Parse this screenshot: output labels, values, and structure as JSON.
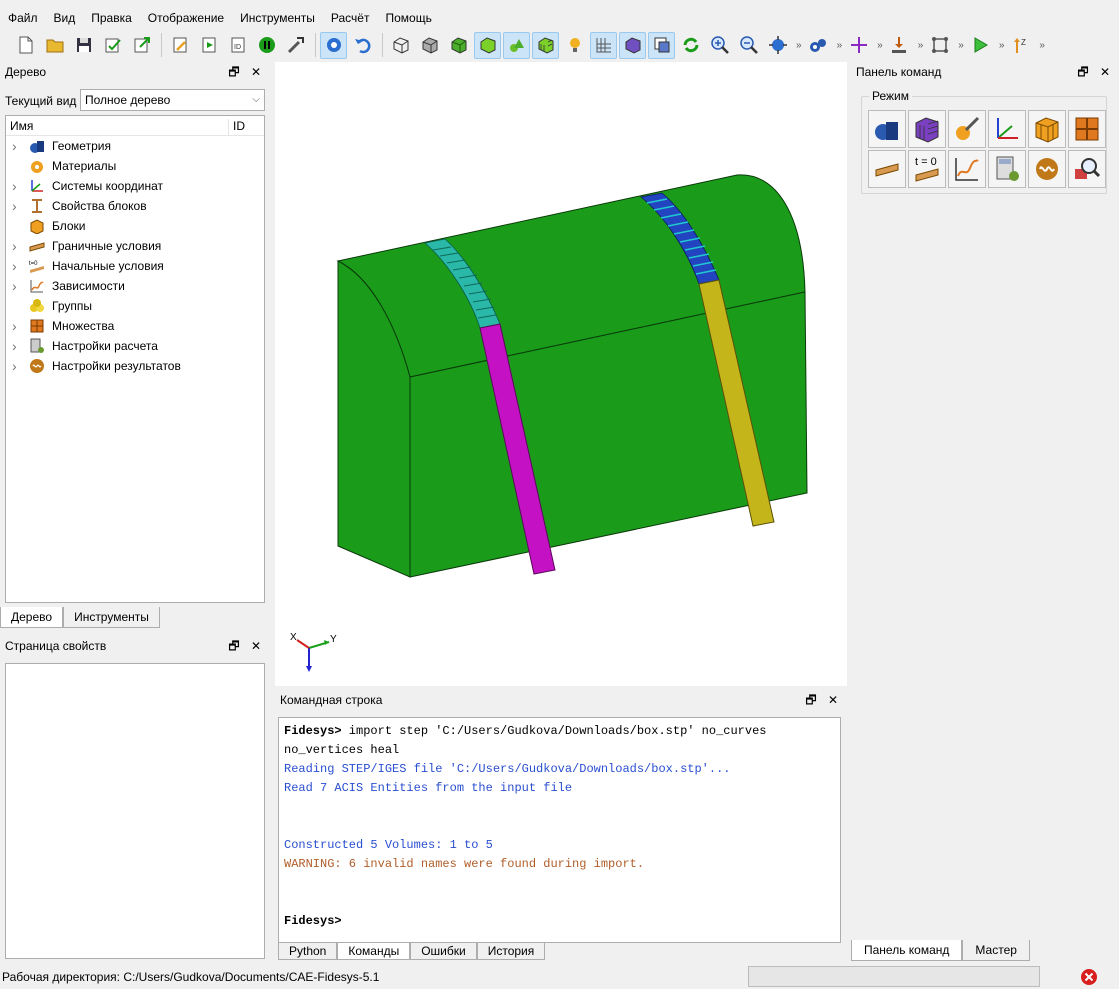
{
  "menu": [
    "Файл",
    "Вид",
    "Правка",
    "Отображение",
    "Инструменты",
    "Расчёт",
    "Помощь"
  ],
  "toolbar": {
    "icons": [
      "new-file-icon",
      "open-folder-icon",
      "save-icon",
      "check-icon",
      "export-icon",
      "edit-script-icon",
      "run-script-icon",
      "id-icon",
      "pause-icon",
      "tools-icon",
      "select-icon",
      "undo-icon",
      "wireframe-cube-icon",
      "gray-cube-icon",
      "green-cube-icon",
      "solid-cube-icon",
      "shapes-icon",
      "mesh-cube-icon",
      "lightbulb-icon",
      "grid-icon",
      "purple-cube-icon",
      "window-icon",
      "refresh-icon",
      "zoom-in-icon",
      "zoom-out-icon",
      "fit-view-icon",
      "gears-icon",
      "crosshair-icon",
      "constraint-icon",
      "layout-icon",
      "run-icon",
      "z-axis-icon"
    ]
  },
  "tree_panel": {
    "title": "Дерево",
    "current_view_label": "Текущий вид",
    "current_view_value": "Полное дерево",
    "col_name": "Имя",
    "col_id": "ID",
    "items": [
      {
        "label": "Геометрия",
        "icon": "geometry-icon",
        "expandable": true
      },
      {
        "label": "Материалы",
        "icon": "materials-icon",
        "expandable": false
      },
      {
        "label": "Системы координат",
        "icon": "coordinate-systems-icon",
        "expandable": true
      },
      {
        "label": "Свойства блоков",
        "icon": "block-properties-icon",
        "expandable": true
      },
      {
        "label": "Блоки",
        "icon": "blocks-icon",
        "expandable": false
      },
      {
        "label": "Граничные условия",
        "icon": "boundary-conditions-icon",
        "expandable": true
      },
      {
        "label": "Начальные условия",
        "icon": "initial-conditions-icon",
        "expandable": true
      },
      {
        "label": "Зависимости",
        "icon": "dependencies-icon",
        "expandable": true
      },
      {
        "label": "Группы",
        "icon": "groups-icon",
        "expandable": false
      },
      {
        "label": "Множества",
        "icon": "sets-icon",
        "expandable": true
      },
      {
        "label": "Настройки расчета",
        "icon": "calc-settings-icon",
        "expandable": true
      },
      {
        "label": "Настройки результатов",
        "icon": "result-settings-icon",
        "expandable": true
      }
    ],
    "tabs": [
      "Дерево",
      "Инструменты"
    ]
  },
  "props_panel": {
    "title": "Страница свойств"
  },
  "viewport": {
    "axis_x": "X",
    "axis_y": "Y"
  },
  "command_panel": {
    "title": "Командная строка",
    "lines": [
      {
        "prompt": "Fidesys>",
        "text": " import step 'C:/Users/Gudkova/Downloads/box.stp' no_curves",
        "cls": "p"
      },
      {
        "prompt": "",
        "text": "no_vertices heal",
        "cls": ""
      },
      {
        "prompt": "",
        "text": "Reading STEP/IGES file 'C:/Users/Gudkova/Downloads/box.stp'...",
        "cls": "blue"
      },
      {
        "prompt": "",
        "text": "Read 7 ACIS Entities from the input file",
        "cls": "blue"
      },
      {
        "prompt": "",
        "text": "",
        "cls": ""
      },
      {
        "prompt": "",
        "text": "",
        "cls": ""
      },
      {
        "prompt": "",
        "text": "Constructed 5 Volumes: 1 to 5",
        "cls": "blue"
      },
      {
        "prompt": "",
        "text": "WARNING: 6 invalid names were found during import.",
        "cls": "warn"
      },
      {
        "prompt": "",
        "text": "",
        "cls": ""
      },
      {
        "prompt": "",
        "text": "",
        "cls": ""
      },
      {
        "prompt": "Fidesys>",
        "text": "",
        "cls": "p"
      }
    ],
    "tabs": [
      "Python",
      "Команды",
      "Ошибки",
      "История"
    ]
  },
  "right_panel": {
    "title": "Панель команд",
    "mode_label": "Режим",
    "mode_buttons": [
      "geometry-mode-icon",
      "mesh-mode-icon",
      "material-mode-icon",
      "coordinate-mode-icon",
      "blocks-mode-icon",
      "sets-mode-icon",
      "boundary-mode-icon",
      "initial-mode-icon",
      "dependency-mode-icon",
      "calculation-mode-icon",
      "results-mode-icon",
      "analysis-mode-icon"
    ],
    "initial_mode_text": "t = 0",
    "tabs": [
      "Панель команд",
      "Мастер"
    ]
  },
  "status": {
    "text": "Рабочая директория: C:/Users/Gudkova/Documents/CAE-Fidesys-5.1"
  },
  "colors": {
    "solid": "#1a9c1a",
    "band_magenta": "#c411c4",
    "band_olive": "#c4b51a"
  }
}
